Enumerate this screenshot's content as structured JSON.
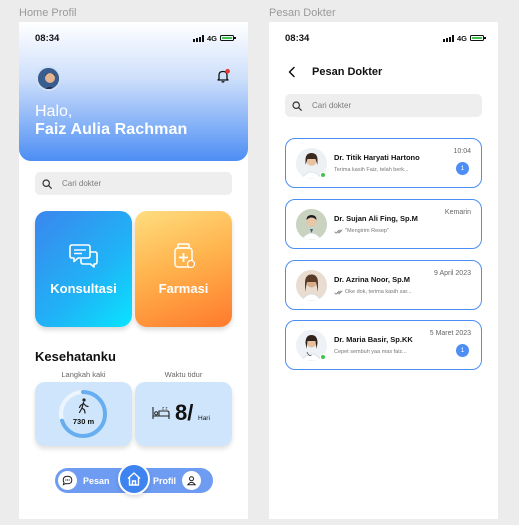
{
  "frames": {
    "home_label": "Home Profil",
    "pesan_label": "Pesan Dokter"
  },
  "status": {
    "time": "08:34",
    "network": "4G"
  },
  "home": {
    "greeting": "Halo,",
    "user_name": "Faiz Aulia Rachman",
    "search_placeholder": "Cari dokter",
    "tiles": {
      "konsultasi": "Konsultasi",
      "farmasi": "Farmasi"
    },
    "section_title": "Kesehatanku",
    "steps": {
      "label": "Langkah kaki",
      "value": "730 m",
      "progress": 0.7
    },
    "sleep": {
      "label": "Waktu tidur",
      "value": "8/",
      "unit": "Hari"
    },
    "nav": {
      "pesan": "Pesan",
      "profil": "Profil"
    }
  },
  "pesan": {
    "title": "Pesan Dokter",
    "search_placeholder": "Cari dokter",
    "chats": [
      {
        "name": "Dr. Titik Haryati Hartono",
        "message": "Terima kasih Faiz, telah berk...",
        "time": "10:04",
        "unread": "1",
        "online": true,
        "ticks": false
      },
      {
        "name": "Dr. Sujan Ali Fing, Sp.M",
        "message": "\"Mengirim Resep\"",
        "time": "Kemarin",
        "unread": "",
        "online": false,
        "ticks": true
      },
      {
        "name": "Dr. Azrina Noor, Sp.M",
        "message": "Oke dok, terima kasih sar...",
        "time": "9 April 2023",
        "unread": "",
        "online": false,
        "ticks": true
      },
      {
        "name": "Dr. Maria Basir, Sp.KK",
        "message": "Cepet sembuh yaa mas faiz...",
        "time": "5 Maret 2023",
        "unread": "1",
        "online": true,
        "ticks": false
      }
    ]
  },
  "colors": {
    "accent": "#4d8ef4",
    "online": "#43c24f",
    "stat_bg": "#cfe5fb"
  }
}
